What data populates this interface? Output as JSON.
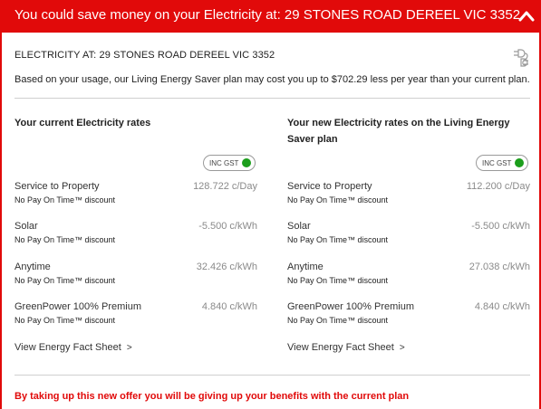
{
  "banner": {
    "title": "You could save money on your Electricity at: 29 STONES ROAD DEREEL VIC 3352",
    "chevron_icon": "chevron-up-icon",
    "color": "#e10a0a"
  },
  "header": {
    "address": "ELECTRICITY AT: 29 STONES ROAD DEREEL VIC 3352",
    "plug_icon": "electric-plug-icon",
    "summary": "Based on your usage, our Living Energy Saver plan may cost you up to $702.29 less per year than your current plan."
  },
  "current": {
    "title": "Your current Electricity rates",
    "toggle_label": "INC GST",
    "rates": [
      {
        "name": "Service to Property",
        "value": "128.722 c/Day",
        "note": "No Pay On Time™ discount"
      },
      {
        "name": "Solar",
        "value": "-5.500 c/kWh",
        "note": "No Pay On Time™ discount"
      },
      {
        "name": "Anytime",
        "value": "32.426 c/kWh",
        "note": "No Pay On Time™ discount"
      },
      {
        "name": "GreenPower 100% Premium",
        "value": "4.840 c/kWh",
        "note": "No Pay On Time™ discount"
      }
    ],
    "fact_sheet_link": "View Energy Fact Sheet",
    "fact_sheet_arrow": ">"
  },
  "new": {
    "title": "Your new Electricity rates on the Living Energy Saver plan",
    "toggle_label": "INC GST",
    "rates": [
      {
        "name": "Service to Property",
        "value": "112.200 c/Day",
        "note": "No Pay On Time™ discount"
      },
      {
        "name": "Solar",
        "value": "-5.500 c/kWh",
        "note": "No Pay On Time™ discount"
      },
      {
        "name": "Anytime",
        "value": "27.038 c/kWh",
        "note": "No Pay On Time™ discount"
      },
      {
        "name": "GreenPower 100% Premium",
        "value": "4.840 c/kWh",
        "note": "No Pay On Time™ discount"
      }
    ],
    "fact_sheet_link": "View Energy Fact Sheet",
    "fact_sheet_arrow": ">"
  },
  "warning": "By taking up this new offer you will be giving up your benefits with the current plan",
  "colors": {
    "accent": "#e10a0a",
    "toggle_on": "#1c9e1c",
    "muted_value": "#8a8a8a"
  }
}
